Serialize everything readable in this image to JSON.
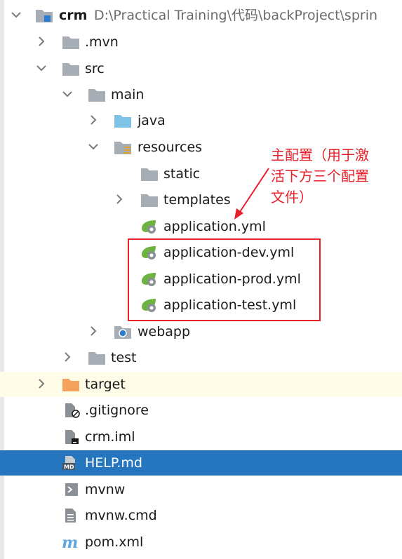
{
  "project": {
    "name": "crm",
    "path": "D:\\Practical Training\\代码\\backProject\\sprin"
  },
  "tree": {
    "mvn": ".mvn",
    "src": "src",
    "main": "main",
    "java": "java",
    "resources": "resources",
    "static": "static",
    "templates": "templates",
    "application_yml": "application.yml",
    "application_dev": "application-dev.yml",
    "application_prod": "application-prod.yml",
    "application_test": "application-test.yml",
    "webapp": "webapp",
    "test": "test",
    "target": "target",
    "gitignore": ".gitignore",
    "crm_iml": "crm.iml",
    "help_md": "HELP.md",
    "mvnw": "mvnw",
    "mvnw_cmd": "mvnw.cmd",
    "pom_xml": "pom.xml"
  },
  "annotation": {
    "line1": "主配置（用于激",
    "line2": "活下方三个配置",
    "line3": "文件）"
  },
  "colors": {
    "selection": "#2675bf",
    "highlight_row": "#fefbe6",
    "annotation": "#e8202a",
    "folder": "#a6adb5",
    "source_folder": "#7cc3e6",
    "excluded_folder": "#f5a25e",
    "spring": "#6db33f"
  },
  "icons": {
    "expanded": "chevron-down-icon",
    "collapsed": "chevron-right-icon",
    "folder": "folder-icon",
    "spring_config": "spring-yml-icon",
    "markdown": "markdown-file-icon",
    "maven": "maven-icon"
  }
}
